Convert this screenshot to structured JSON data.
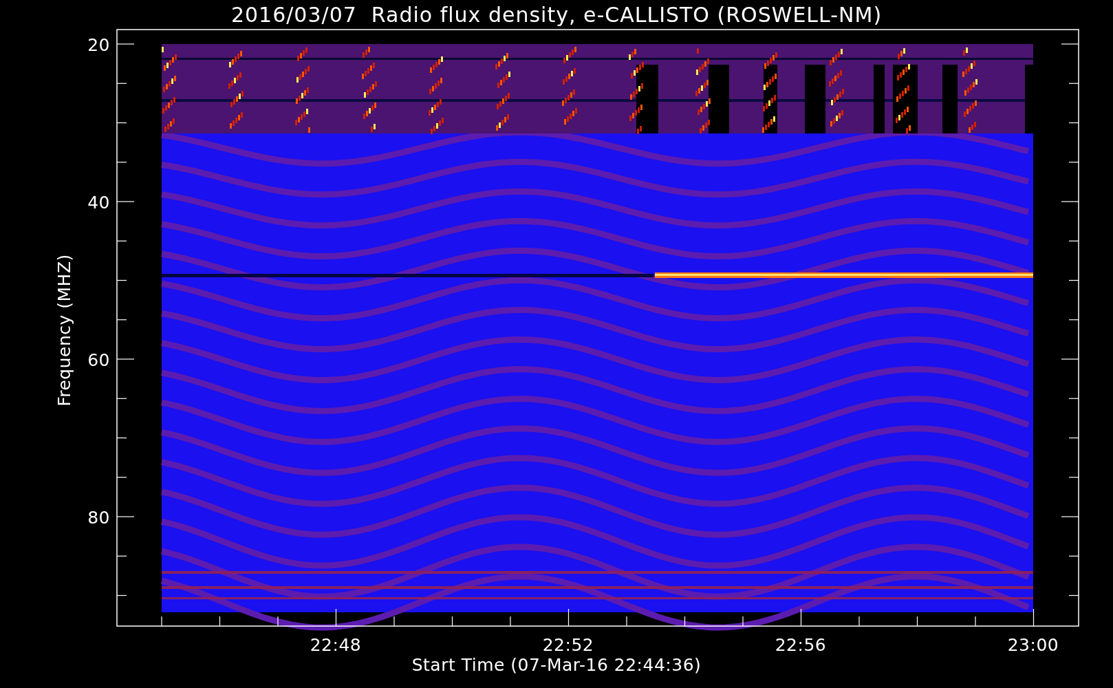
{
  "title": "2016/03/07  Radio flux density, e-CALLISTO (ROSWELL-NM)",
  "y_axis": {
    "label": "Frequency (MHZ)",
    "ticks": [
      "20",
      "40",
      "60",
      "80"
    ]
  },
  "x_axis": {
    "label": "Start Time (07-Mar-16 22:44:36)",
    "ticks": [
      "22:48",
      "22:52",
      "22:56",
      "23:00"
    ]
  }
}
